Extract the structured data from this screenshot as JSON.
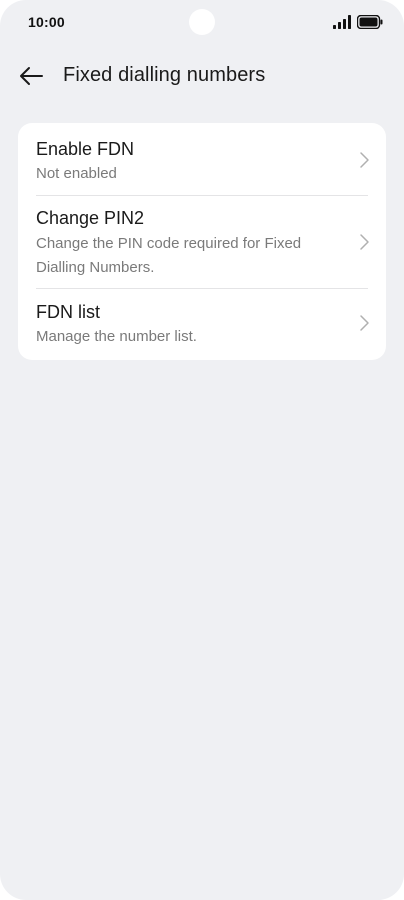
{
  "status_bar": {
    "time": "10:00",
    "signal_icon": "signal-bars-icon",
    "battery_icon": "battery-full-icon"
  },
  "app_bar": {
    "back_icon": "arrow-left-icon",
    "title": "Fixed dialling numbers"
  },
  "settings": {
    "items": [
      {
        "title": "Enable FDN",
        "subtitle": "Not enabled",
        "icon": "chevron-right-icon"
      },
      {
        "title": "Change PIN2",
        "subtitle": "Change the PIN code required for Fixed Dialling Numbers.",
        "icon": "chevron-right-icon"
      },
      {
        "title": "FDN list",
        "subtitle": "Manage the number list.",
        "icon": "chevron-right-icon"
      }
    ]
  },
  "colors": {
    "background": "#eff0f3",
    "card": "#ffffff",
    "title_text": "#1a1a1a",
    "secondary_text": "#7a7a7a",
    "chevron": "#b0b0b0"
  }
}
